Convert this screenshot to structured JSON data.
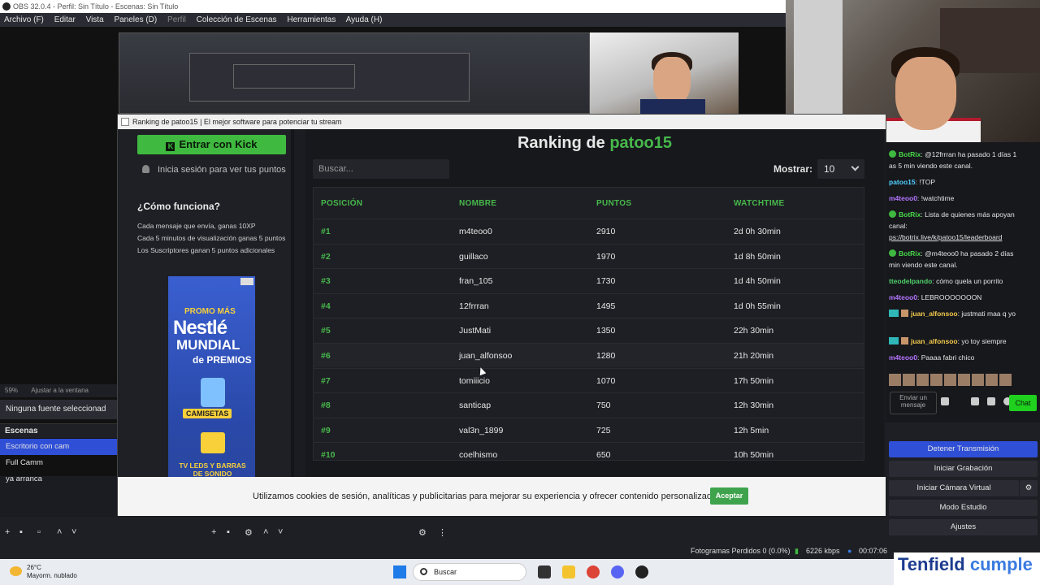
{
  "window": {
    "title": "OBS 32.0.4 - Perfil: Sin Título - Escenas: Sin Título"
  },
  "menu": {
    "items": [
      "Archivo (F)",
      "Editar",
      "Vista",
      "Paneles (D)",
      "Perfil",
      "Colección de Escenas",
      "Herramientas",
      "Ayuda (H)"
    ]
  },
  "browser": {
    "tab_title": "Ranking de patoo15 | El mejor software para potenciar tu stream",
    "kick_button": "Entrar con Kick",
    "login_points": "Inicia sesión para ver tus puntos",
    "how_heading": "¿Cómo funciona?",
    "how_lines": [
      "Cada mensaje que envía, ganas 10XP",
      "Cada 5 minutos de visualización ganas 5 puntos",
      "Los Suscriptores ganan 5 puntos adicionales"
    ],
    "ad": {
      "promo": "PROMO MÁS",
      "brand": "Nestlé",
      "mundial": "MUNDIAL",
      "premios": "de PREMIOS",
      "tag1": "CAMISETAS",
      "tag2": "TV LEDS Y BARRAS DE SONIDO"
    },
    "ranking_title_prefix": "Ranking de ",
    "ranking_user": "patoo15",
    "search_placeholder": "Buscar...",
    "show_label": "Mostrar:",
    "show_value": "10",
    "headers": [
      "POSICIÓN",
      "NOMBRE",
      "PUNTOS",
      "WATCHTIME"
    ],
    "rows": [
      {
        "pos": "#1",
        "name": "m4teoo0",
        "points": "2910",
        "watch": "2d 0h 30min"
      },
      {
        "pos": "#2",
        "name": "guillaco",
        "points": "1970",
        "watch": "1d 8h 50min"
      },
      {
        "pos": "#3",
        "name": "fran_105",
        "points": "1730",
        "watch": "1d 4h 50min"
      },
      {
        "pos": "#4",
        "name": "12frrran",
        "points": "1495",
        "watch": "1d 0h 55min"
      },
      {
        "pos": "#5",
        "name": "JustMati",
        "points": "1350",
        "watch": "22h 30min"
      },
      {
        "pos": "#6",
        "name": "juan_alfonsoo",
        "points": "1280",
        "watch": "21h 20min"
      },
      {
        "pos": "#7",
        "name": "tomiiicio",
        "points": "1070",
        "watch": "17h 50min"
      },
      {
        "pos": "#8",
        "name": "santicap",
        "points": "750",
        "watch": "12h 30min"
      },
      {
        "pos": "#9",
        "name": "val3n_1899",
        "points": "725",
        "watch": "12h 5min"
      },
      {
        "pos": "#10",
        "name": "coelhismo",
        "points": "650",
        "watch": "10h 50min"
      }
    ],
    "cookie_text": "Utilizamos cookies de sesión, analíticas y publicitarias para mejorar su experiencia y ofrecer contenido personalizado.",
    "cookie_accept": "Aceptar"
  },
  "chat": {
    "messages": [
      {
        "user": "BotRix",
        "text": ": @12frrran ha pasado 1 días 1",
        "cont": "as 5 min viendo este canal."
      },
      {
        "user": "patoo15",
        "text": ": !TOP"
      },
      {
        "user": "m4teoo0",
        "text": ": !watchtime"
      },
      {
        "user": "BotRix",
        "text": ": Lista de quienes más apoyan",
        "cont": "canal:",
        "link": "ps://botrix.live/k/patoo15/leaderboard"
      },
      {
        "user": "BotRix",
        "text": ": @m4teoo0 ha pasado 2 días",
        "cont": "min viendo este canal."
      },
      {
        "user": "tteodelpando",
        "text": ": cómo quela un porrito"
      },
      {
        "user": "m4teoo0",
        "text": ": LEBROOOOOOON"
      },
      {
        "user": "juan_alfonsoo",
        "text": ": justmati maa q yo"
      },
      {
        "user": "juan_alfonsoo",
        "text": ": yo toy siempre"
      },
      {
        "user": "m4teoo0",
        "text": ": Paaaa fabri chico"
      }
    ],
    "input_placeholder": "Enviar un mensaje",
    "send": "Chat"
  },
  "obs": {
    "zoom": "59%",
    "fit": "Ajustar a la ventana",
    "no_source": "Ninguna fuente seleccionad",
    "scenes_label": "Escenas",
    "scenes": [
      "Escritorio con cam",
      "Full Camm",
      "ya arranca"
    ],
    "controls": [
      "Detener Transmisión",
      "Iniciar Grabación",
      "Iniciar Cámara Virtual",
      "Modo Estudio",
      "Ajustes"
    ],
    "dropped": "Fotogramas Perdidos 0 (0.0%)",
    "kbps": "6226 kbps",
    "time": "00:07:06"
  },
  "taskbar": {
    "temp": "26°C",
    "weather": "Mayorm. nublado",
    "search": "Buscar"
  },
  "overlay": {
    "brand1": "Tenfield ",
    "brand2": "cumple"
  }
}
